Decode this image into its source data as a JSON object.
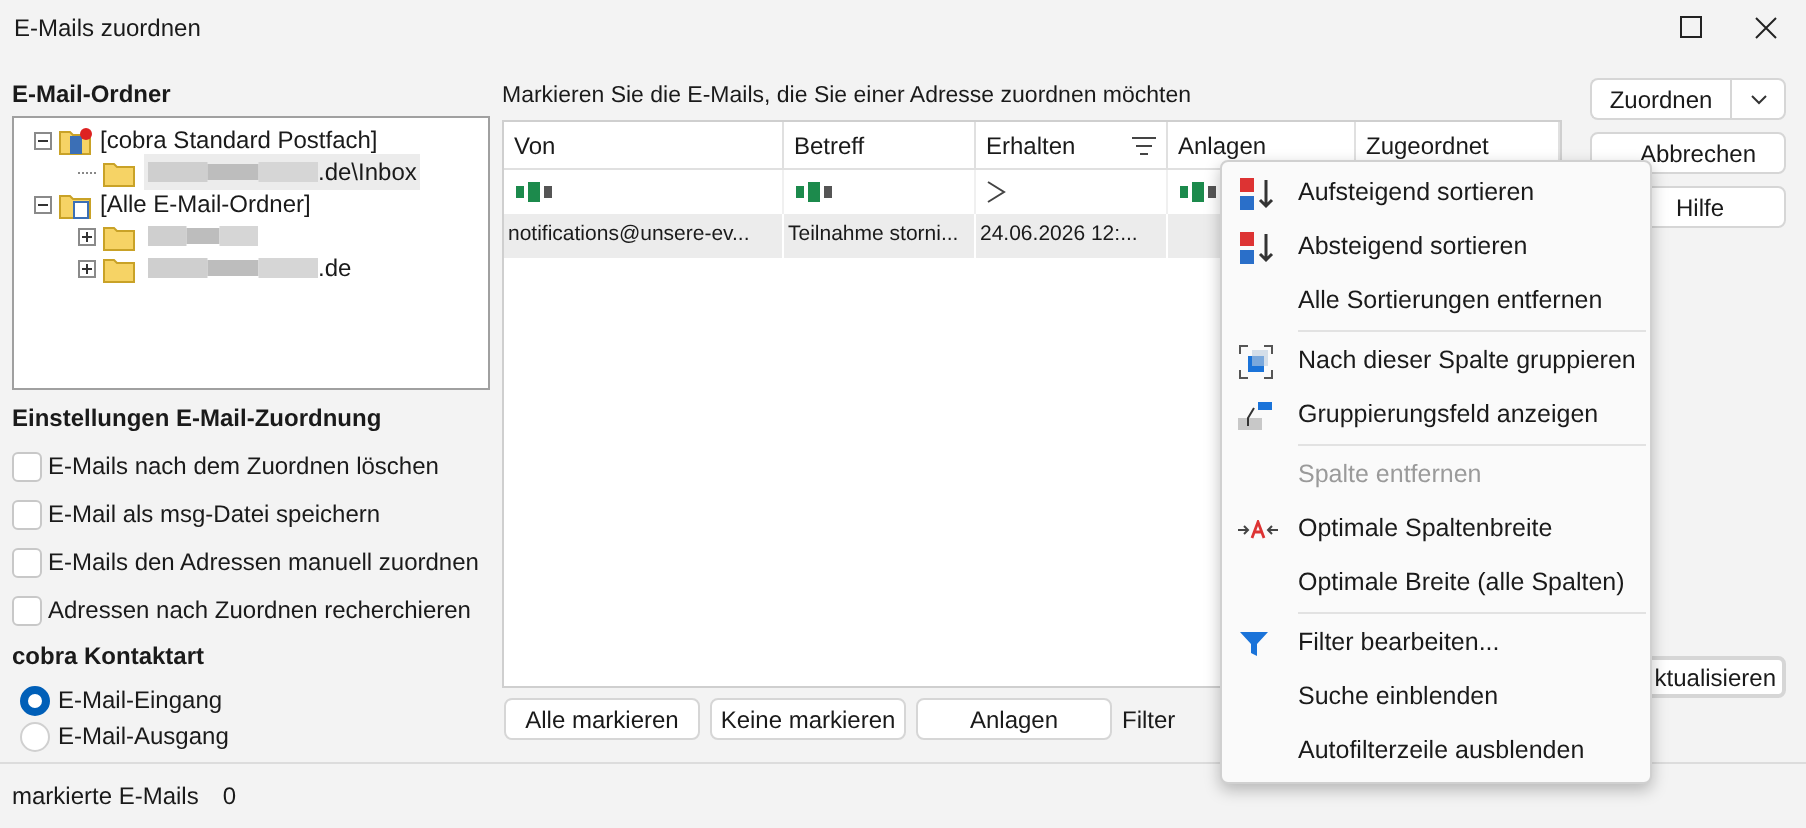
{
  "window": {
    "title": "E-Mails zuordnen"
  },
  "folders": {
    "heading": "E-Mail-Ordner",
    "tree": [
      {
        "label": "[cobra Standard Postfach]",
        "expanded": true,
        "children": [
          {
            "label": ".de\\Inbox",
            "selected": true
          }
        ]
      },
      {
        "label": "[Alle E-Mail-Ordner]",
        "expanded": true,
        "children": [
          {
            "expanded": false,
            "selected": false
          },
          {
            "label": ".de",
            "expanded": false,
            "selected": false
          }
        ]
      }
    ]
  },
  "settings": {
    "heading": "Einstellungen E-Mail-Zuordnung",
    "options": [
      {
        "label": "E-Mails nach dem Zuordnen löschen",
        "checked": false
      },
      {
        "label": "E-Mail als msg-Datei speichern",
        "checked": false
      },
      {
        "label": "E-Mails den Adressen manuell zuordnen",
        "checked": false
      },
      {
        "label": "Adressen nach Zuordnen recherchieren",
        "checked": false
      }
    ]
  },
  "contact_type": {
    "heading": "cobra Kontaktart",
    "options": [
      {
        "label": "E-Mail-Eingang",
        "selected": true
      },
      {
        "label": "E-Mail-Ausgang",
        "selected": false
      }
    ]
  },
  "table": {
    "caption": "Markieren Sie die E-Mails, die Sie einer Adresse zuordnen möchten",
    "columns": [
      {
        "label": "Von",
        "kind": "text",
        "sort_menu": false
      },
      {
        "label": "Betreff",
        "kind": "text",
        "sort_menu": false
      },
      {
        "label": "Erhalten",
        "kind": "compare",
        "sort_menu": true
      },
      {
        "label": "Anlagen",
        "kind": "text",
        "sort_menu": false
      },
      {
        "label": "Zugeordnet",
        "kind": "none",
        "sort_menu": false
      }
    ],
    "rows": [
      {
        "cells": [
          "notifications@unsere-ev...",
          "Teilnahme storni...",
          "24.06.2026 12:...",
          ""
        ],
        "selected": true
      }
    ]
  },
  "table_buttons": [
    "Alle markieren",
    "Keine markieren",
    "Anlagen"
  ],
  "filter_label": "Filter",
  "actions": {
    "assign": "Zuordnen",
    "cancel": "Abbrechen",
    "help": "Hilfe",
    "refresh": "ktualisieren"
  },
  "status": {
    "label": "markierte E-Mails",
    "count": "0"
  },
  "context_menu": [
    {
      "kind": "item",
      "label": "Aufsteigend sortieren",
      "disabled": false
    },
    {
      "kind": "item",
      "label": "Absteigend sortieren",
      "disabled": false
    },
    {
      "kind": "item",
      "label": "Alle Sortierungen entfernen",
      "disabled": false
    },
    {
      "kind": "separator"
    },
    {
      "kind": "item",
      "label": "Nach dieser Spalte gruppieren",
      "disabled": false
    },
    {
      "kind": "item",
      "label": "Gruppierungsfeld anzeigen",
      "disabled": false
    },
    {
      "kind": "separator"
    },
    {
      "kind": "item",
      "label": "Spalte entfernen",
      "disabled": true
    },
    {
      "kind": "item",
      "label": "Optimale Spaltenbreite",
      "disabled": false
    },
    {
      "kind": "item",
      "label": "Optimale Breite (alle Spalten)",
      "disabled": false
    },
    {
      "kind": "separator"
    },
    {
      "kind": "item",
      "label": "Filter bearbeiten...",
      "disabled": false
    },
    {
      "kind": "item",
      "label": "Suche einblenden",
      "disabled": false
    },
    {
      "kind": "item",
      "label": "Autofilterzeile ausblenden",
      "disabled": false
    }
  ]
}
